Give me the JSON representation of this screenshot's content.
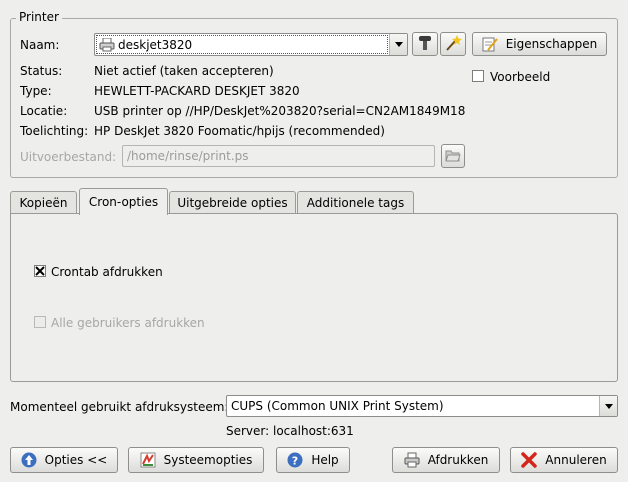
{
  "printer_group": {
    "title": "Printer",
    "name_label": "Naam:",
    "selected_printer": "deskjet3820",
    "properties_button": "Eigenschappen",
    "preview_label": "Voorbeeld",
    "status_label": "Status:",
    "status_value": "Niet actief (taken accepteren)",
    "type_label": "Type:",
    "type_value": "HEWLETT-PACKARD DESKJET 3820",
    "location_label": "Locatie:",
    "location_value": "USB printer op //HP/DeskJet%203820?serial=CN2AM1849M18",
    "comment_label": "Toelichting:",
    "comment_value": "HP DeskJet 3820 Foomatic/hpijs (recommended)",
    "output_file_label": "Uitvoerbestand:",
    "output_file_value": "/home/rinse/print.ps"
  },
  "tabs": [
    {
      "label": "Kopieën"
    },
    {
      "label": "Cron-opties"
    },
    {
      "label": "Uitgebreide opties"
    },
    {
      "label": "Additionele tags"
    }
  ],
  "cron_tab": {
    "crontab_print_label": "Crontab afdrukken",
    "crontab_print_checked": true,
    "all_users_label": "Alle gebruikers afdrukken",
    "all_users_checked": false
  },
  "print_system": {
    "label": "Momenteel gebruikt afdruksysteem:",
    "value": "CUPS (Common UNIX Print System)",
    "server": "Server: localhost:631"
  },
  "buttons": {
    "options": "Opties <<",
    "system_options": "Systeemopties",
    "help": "Help",
    "print": "Afdrukken",
    "cancel": "Annuleren"
  },
  "icons": {
    "printer": "printer-icon",
    "toner": "toner-icon",
    "wizard": "wizard-icon",
    "properties": "properties-icon",
    "folder": "folder-open-icon",
    "options": "up-arrow-icon",
    "system": "system-options-icon",
    "help": "help-icon",
    "print": "printer-icon",
    "cancel": "cancel-icon"
  }
}
